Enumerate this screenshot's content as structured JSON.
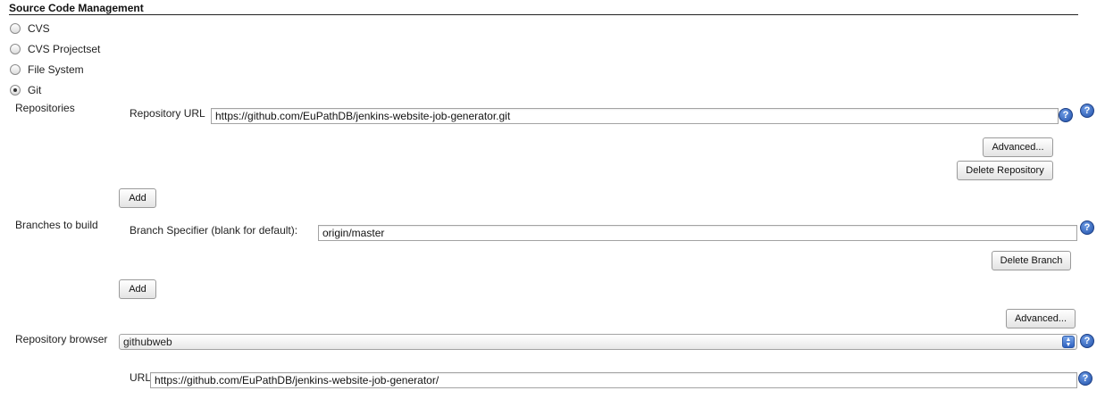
{
  "section": {
    "title": "Source Code Management"
  },
  "scm_options": [
    {
      "label": "CVS",
      "checked": false
    },
    {
      "label": "CVS Projectset",
      "checked": false
    },
    {
      "label": "File System",
      "checked": false
    },
    {
      "label": "Git",
      "checked": true
    }
  ],
  "repositories": {
    "label": "Repositories",
    "url_label": "Repository URL",
    "url_value": "https://github.com/EuPathDB/jenkins-website-job-generator.git",
    "advanced_label": "Advanced...",
    "delete_label": "Delete Repository",
    "add_label": "Add"
  },
  "branches": {
    "label": "Branches to build",
    "specifier_label": "Branch Specifier (blank for default):",
    "specifier_value": "origin/master",
    "delete_label": "Delete Branch",
    "add_label": "Add"
  },
  "advanced_label": "Advanced...",
  "repo_browser": {
    "label": "Repository browser",
    "selected": "githubweb",
    "url_label": "URL",
    "url_value": "https://github.com/EuPathDB/jenkins-website-job-generator/"
  },
  "help_glyph": "?",
  "icons": {
    "help": "help-icon",
    "select_arrows": "up-down-arrows-icon"
  },
  "colors": {
    "help_blue": "#2a5bb5",
    "rule": "#222222"
  }
}
